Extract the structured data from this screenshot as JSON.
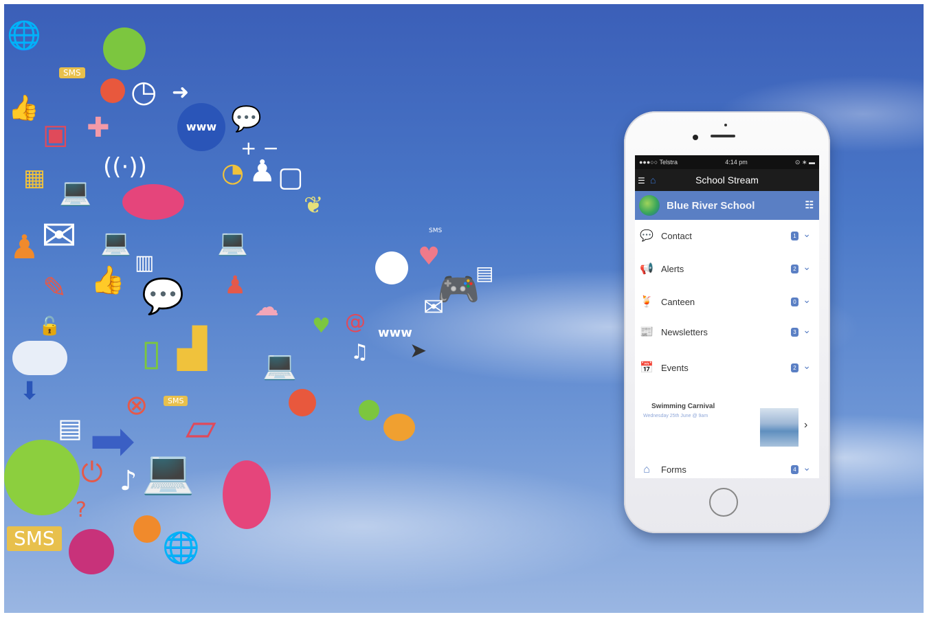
{
  "colors": {
    "sky_top": "#3b5fb8",
    "sky_bottom": "#9ab6e2",
    "app_header": "#1c1c1c",
    "school_bar": "#5a7fc4",
    "accent": "#5a7fc4"
  },
  "background_art": {
    "sms_labels": [
      "SMS",
      "SMS",
      "SMS",
      "SMS"
    ],
    "www_labels": [
      "www",
      "www"
    ]
  },
  "phone": {
    "status": {
      "carrier": "●●●○○ Telstra",
      "time": "4:14 pm",
      "right": "⊙ ∗ ▬"
    },
    "app_title": "School Stream",
    "school_name": "Blue River School",
    "menu": [
      {
        "label": "Contact",
        "icon": "chat-icon",
        "count": "1"
      },
      {
        "label": "Alerts",
        "icon": "megaphone-icon",
        "count": "2"
      },
      {
        "label": "Canteen",
        "icon": "drink-icon",
        "count": "0"
      },
      {
        "label": "Newsletters",
        "icon": "newsletter-icon",
        "count": "3"
      },
      {
        "label": "Events",
        "icon": "calendar-icon",
        "count": "2"
      },
      {
        "label": "Forms",
        "icon": "form-icon",
        "count": "4"
      }
    ],
    "event": {
      "title": "Swimming Carnival",
      "date": "Wednesday 25th June @ 9am"
    }
  }
}
